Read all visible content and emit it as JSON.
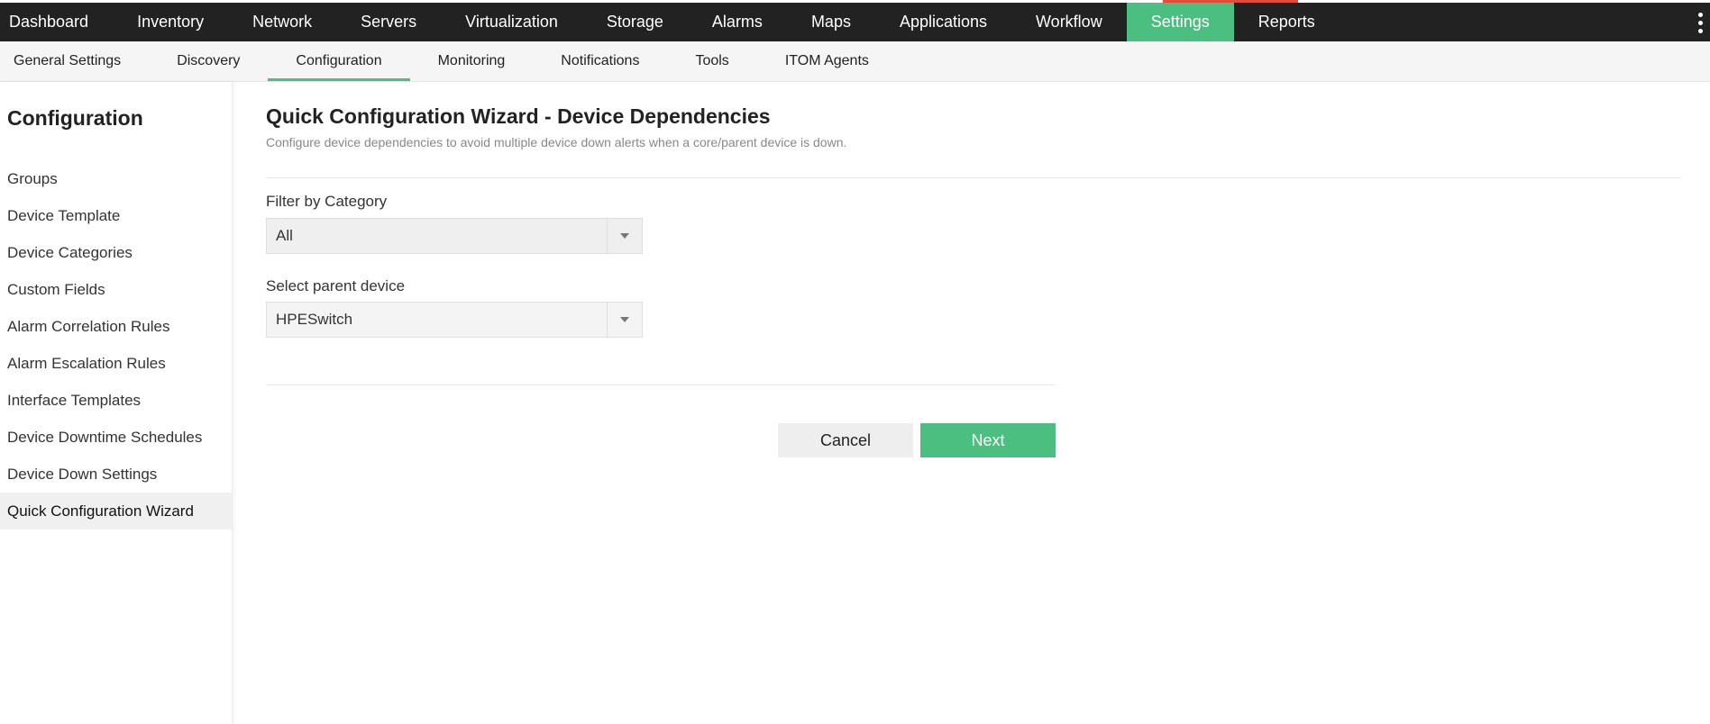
{
  "topnav": {
    "items": [
      "Dashboard",
      "Inventory",
      "Network",
      "Servers",
      "Virtualization",
      "Storage",
      "Alarms",
      "Maps",
      "Applications",
      "Workflow",
      "Settings",
      "Reports"
    ],
    "active": "Settings",
    "accent_color": "#4bbf7f",
    "more_icon": "kebab-menu-icon"
  },
  "subnav": {
    "tabs": [
      "General Settings",
      "Discovery",
      "Configuration",
      "Monitoring",
      "Notifications",
      "Tools",
      "ITOM Agents"
    ],
    "active": "Configuration"
  },
  "sidebar": {
    "title": "Configuration",
    "items": [
      "Groups",
      "Device Template",
      "Device Categories",
      "Custom Fields",
      "Alarm Correlation Rules",
      "Alarm Escalation Rules",
      "Interface Templates",
      "Device Downtime Schedules",
      "Device Down Settings",
      "Quick Configuration Wizard"
    ],
    "active": "Quick Configuration Wizard"
  },
  "main": {
    "title": "Quick Configuration Wizard - Device Dependencies",
    "subtitle": "Configure device dependencies to avoid multiple device down alerts when a core/parent device is down.",
    "filter_label": "Filter by Category",
    "filter_value": "All",
    "parent_label": "Select parent device",
    "parent_value": "HPESwitch",
    "cancel_label": "Cancel",
    "next_label": "Next"
  }
}
